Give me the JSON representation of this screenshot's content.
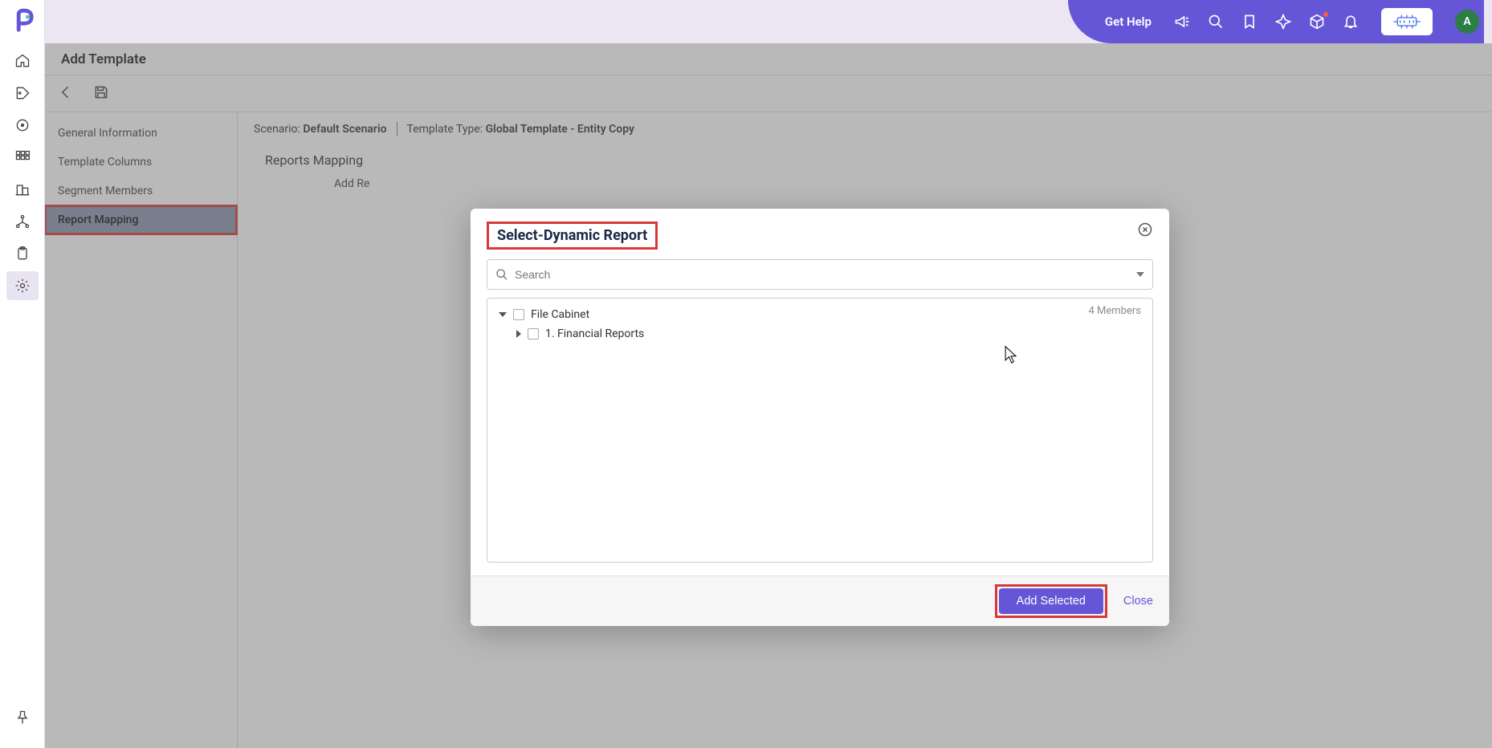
{
  "header": {
    "get_help": "Get Help",
    "avatar_initial": "A"
  },
  "page": {
    "title": "Add Template",
    "scenario_label": "Scenario:",
    "scenario_value": "Default Scenario",
    "template_type_label": "Template Type:",
    "template_type_value": "Global Template - Entity Copy",
    "section_heading": "Reports Mapping",
    "add_report_partial": "Add Re"
  },
  "sidebar_tabs": {
    "items": [
      {
        "label": "General Information"
      },
      {
        "label": "Template Columns"
      },
      {
        "label": "Segment Members"
      },
      {
        "label": "Report Mapping"
      }
    ]
  },
  "modal": {
    "title": "Select-Dynamic Report",
    "search_placeholder": "Search",
    "members_count": "4 Members",
    "tree_root": "File Cabinet",
    "tree_child1": "1. Financial Reports",
    "footer": {
      "primary": "Add Selected",
      "secondary": "Close"
    }
  }
}
